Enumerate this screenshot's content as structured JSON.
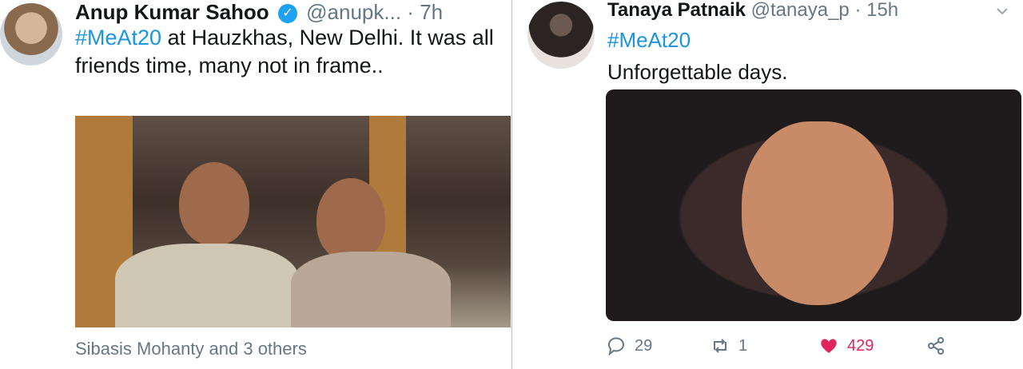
{
  "left_tweet": {
    "author_name": "Anup Kumar Sahoo",
    "handle": "@anupk...",
    "separator": "·",
    "time": "7h",
    "verified_icon": "verified-badge-icon",
    "text_hashtag": "#MeAt20",
    "text_rest": " at Hauzkhas, New Delhi. It was all friends time, many not in frame..",
    "photo_tag_caption": "Sibasis Mohanty and 3 others"
  },
  "right_tweet": {
    "author_name": "Tanaya Patnaik",
    "handle": "@tanaya_p",
    "separator": "·",
    "time": "15h",
    "text_hashtag": "#MeAt20",
    "text_line": "Unforgettable days.",
    "more_icon": "chevron-down-icon",
    "actions": {
      "reply_count": "29",
      "retweet_count": "1",
      "like_count": "429"
    },
    "accent_color": "#1b95e0",
    "like_color": "#e0245e"
  }
}
